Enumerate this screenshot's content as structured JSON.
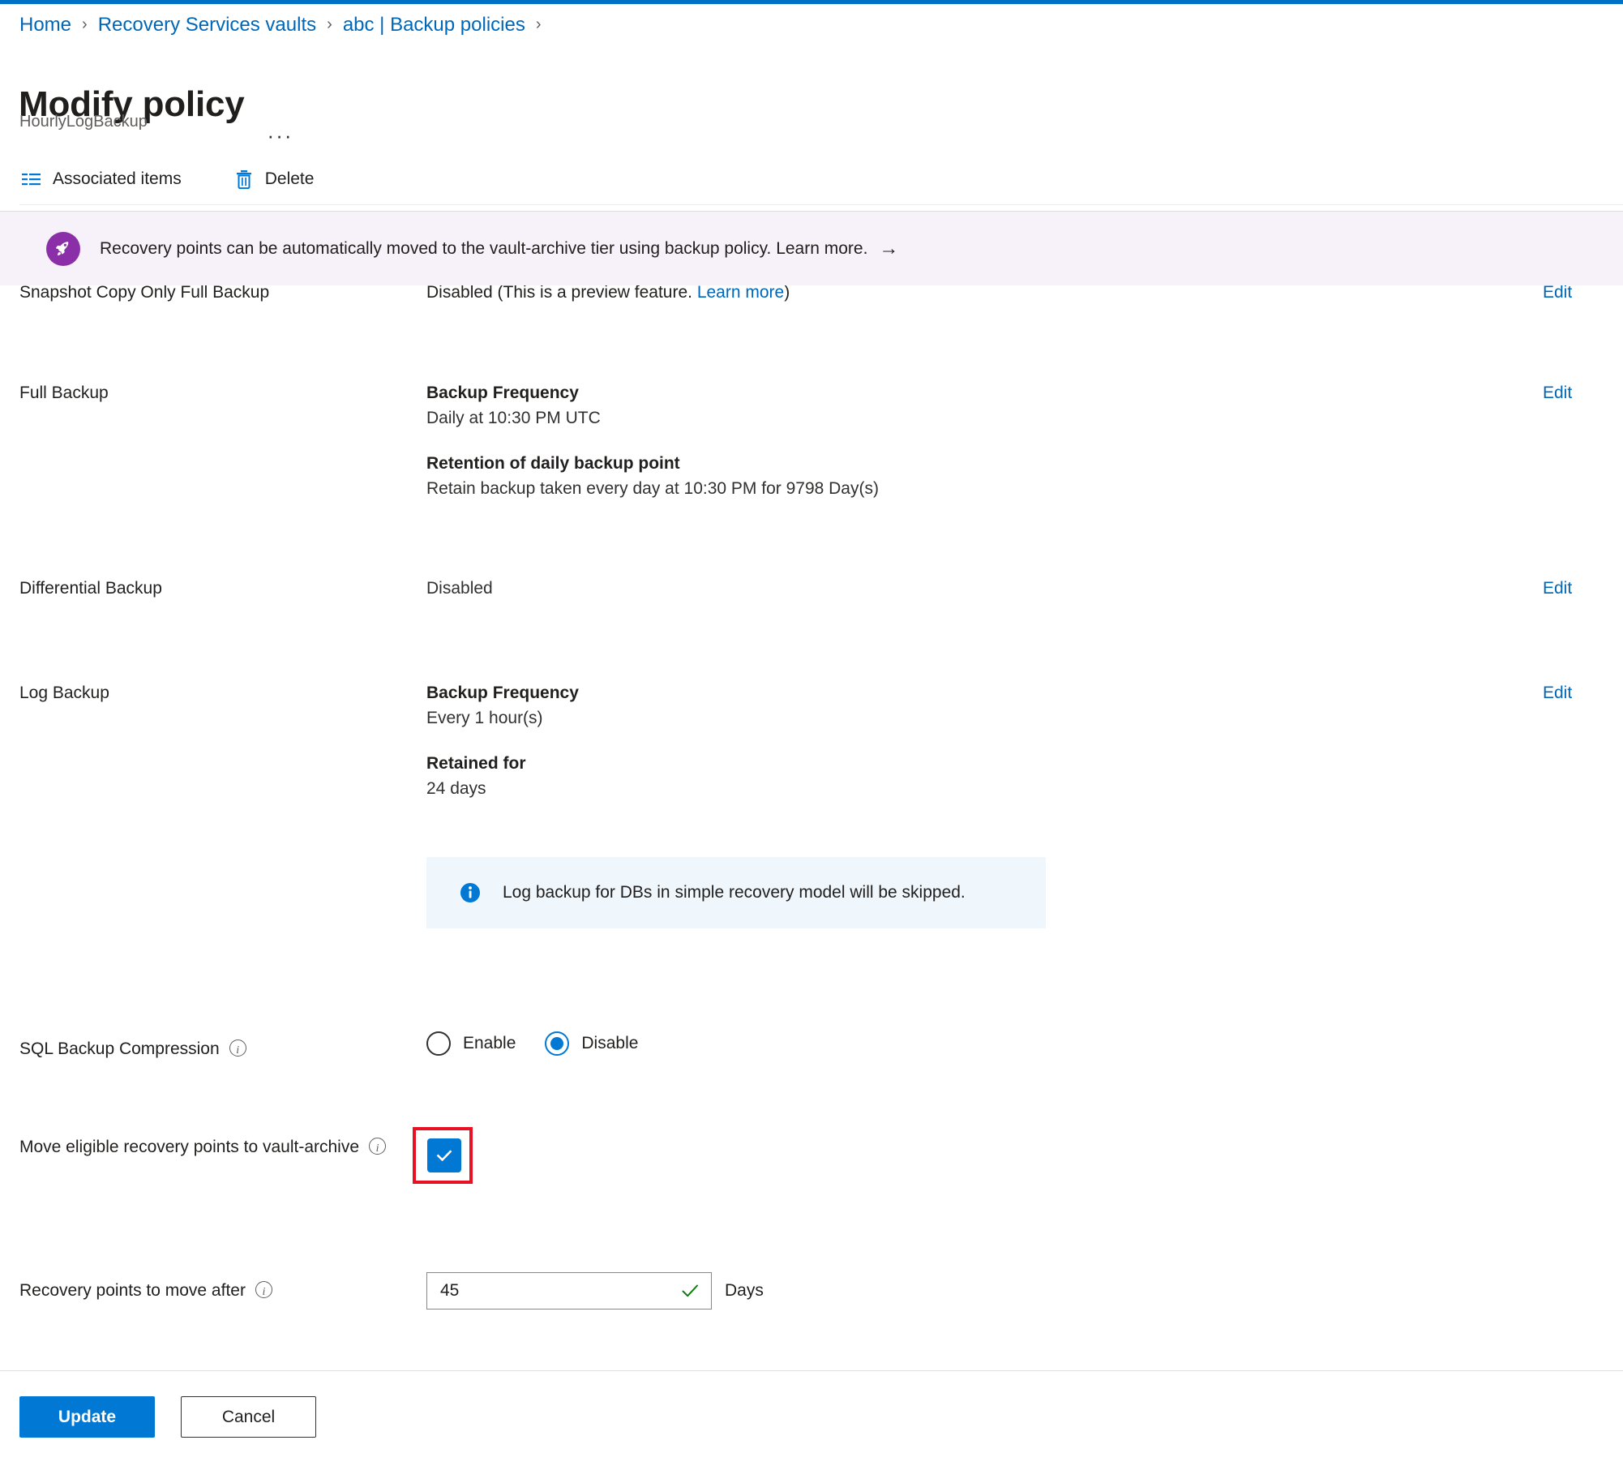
{
  "theme": {
    "accent": "#0078d4",
    "link": "#0067b8",
    "banner_bg": "#f7f2f9",
    "banner_icon_bg": "#8b2fa8",
    "info_bg": "#eff6fc",
    "annotation_red": "#e81123",
    "validation_green": "#107c10"
  },
  "breadcrumb": {
    "items": [
      {
        "label": "Home"
      },
      {
        "label": "Recovery Services vaults"
      },
      {
        "label": "abc | Backup policies"
      }
    ],
    "separator": "›",
    "trailing_separator": "›"
  },
  "header": {
    "title": "Modify policy",
    "more_label": "···",
    "subtitle": "HourlyLogBackup"
  },
  "command_bar": {
    "items": [
      {
        "label": "Associated items",
        "icon": "list-icon"
      },
      {
        "label": "Delete",
        "icon": "trash-icon"
      }
    ]
  },
  "banner": {
    "icon": "rocket-icon",
    "message": "Recovery points can be automatically moved to the vault-archive tier using backup policy. Learn more.",
    "arrow": "→"
  },
  "clipped_row": {
    "label": "Snapshot Copy Only Full Backup",
    "value_prefix": "Disabled (This is a preview feature. ",
    "value_link": "Learn more",
    "value_suffix": ")",
    "edit_label": "Edit"
  },
  "settings": {
    "rows": [
      {
        "label": "Full Backup",
        "edit_label": "Edit",
        "blocks": [
          {
            "heading": "Backup Frequency",
            "text": "Daily at 10:30 PM UTC"
          },
          {
            "heading": "Retention of daily backup point",
            "text": "Retain backup taken every day at 10:30 PM for 9798 Day(s)"
          }
        ]
      },
      {
        "label": "Differential Backup",
        "edit_label": "Edit",
        "blocks": [
          {
            "heading": "",
            "text": "Disabled"
          }
        ]
      },
      {
        "label": "Log Backup",
        "edit_label": "Edit",
        "blocks": [
          {
            "heading": "Backup Frequency",
            "text": "Every 1 hour(s)"
          },
          {
            "heading": "Retained for",
            "text": "24 days"
          }
        ]
      }
    ]
  },
  "info_box": {
    "icon": "info-icon",
    "message": "Log backup for DBs in simple recovery model will be skipped."
  },
  "compression": {
    "label": "SQL Backup Compression",
    "info_icon": "info-circle-icon",
    "options": [
      {
        "label": "Enable",
        "selected": false
      },
      {
        "label": "Disable",
        "selected": true
      }
    ]
  },
  "vault_archive": {
    "label": "Move eligible recovery points to vault-archive",
    "info_icon": "info-circle-icon",
    "checked": true,
    "checkbox_icon": "checkmark-icon",
    "annotated": true
  },
  "move_after": {
    "label": "Recovery points to move after",
    "info_icon": "info-circle-icon",
    "value": "45",
    "placeholder": "",
    "validation_icon": "green-checkmark-icon",
    "unit": "Days"
  },
  "footer": {
    "update_label": "Update",
    "cancel_label": "Cancel"
  }
}
